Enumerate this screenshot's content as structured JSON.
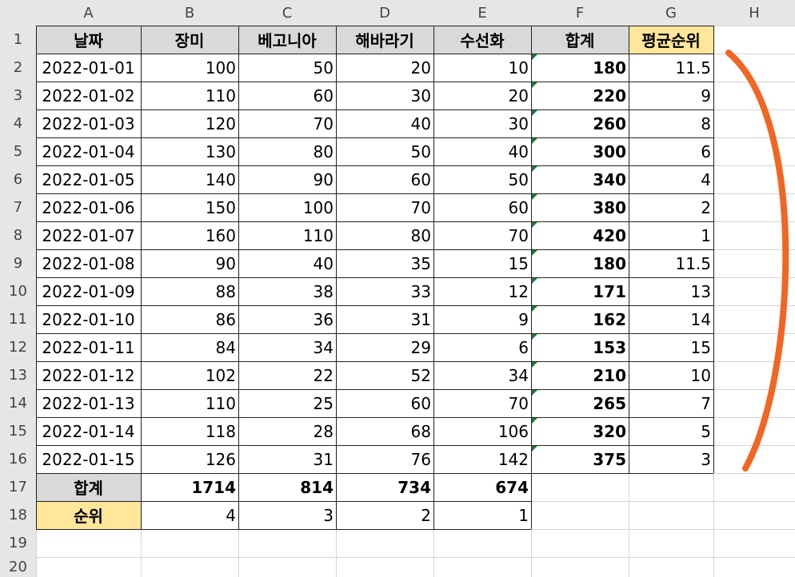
{
  "columns": [
    "A",
    "B",
    "C",
    "D",
    "E",
    "F",
    "G",
    "H"
  ],
  "row_numbers": [
    "1",
    "2",
    "3",
    "4",
    "5",
    "6",
    "7",
    "8",
    "9",
    "10",
    "11",
    "12",
    "13",
    "14",
    "15",
    "16",
    "17",
    "18",
    "19",
    "20"
  ],
  "header_row": [
    "날짜",
    "장미",
    "베고니아",
    "해바라기",
    "수선화",
    "합계",
    "평균순위"
  ],
  "rows": [
    [
      "2022-01-01",
      "100",
      "50",
      "20",
      "10",
      "180",
      "11.5"
    ],
    [
      "2022-01-02",
      "110",
      "60",
      "30",
      "20",
      "220",
      "9"
    ],
    [
      "2022-01-03",
      "120",
      "70",
      "40",
      "30",
      "260",
      "8"
    ],
    [
      "2022-01-04",
      "130",
      "80",
      "50",
      "40",
      "300",
      "6"
    ],
    [
      "2022-01-05",
      "140",
      "90",
      "60",
      "50",
      "340",
      "4"
    ],
    [
      "2022-01-06",
      "150",
      "100",
      "70",
      "60",
      "380",
      "2"
    ],
    [
      "2022-01-07",
      "160",
      "110",
      "80",
      "70",
      "420",
      "1"
    ],
    [
      "2022-01-08",
      "90",
      "40",
      "35",
      "15",
      "180",
      "11.5"
    ],
    [
      "2022-01-09",
      "88",
      "38",
      "33",
      "12",
      "171",
      "13"
    ],
    [
      "2022-01-10",
      "86",
      "36",
      "31",
      "9",
      "162",
      "14"
    ],
    [
      "2022-01-11",
      "84",
      "34",
      "29",
      "6",
      "153",
      "15"
    ],
    [
      "2022-01-12",
      "102",
      "22",
      "52",
      "34",
      "210",
      "10"
    ],
    [
      "2022-01-13",
      "110",
      "25",
      "60",
      "70",
      "265",
      "7"
    ],
    [
      "2022-01-14",
      "118",
      "28",
      "68",
      "106",
      "320",
      "5"
    ],
    [
      "2022-01-15",
      "126",
      "31",
      "76",
      "142",
      "375",
      "3"
    ]
  ],
  "total_row": [
    "합계",
    "1714",
    "814",
    "734",
    "674"
  ],
  "rank_row": [
    "순위",
    "4",
    "3",
    "2",
    "1"
  ],
  "colors": {
    "grid": "#d4d4d4",
    "header_bg": "#e6e6e6",
    "gray_cell": "#d9d9d9",
    "yellow_cell": "#ffe699",
    "comment_marker": "#1e7b34",
    "annotation_arc": "#f26522"
  },
  "annotation": "orange-curved-bracket"
}
